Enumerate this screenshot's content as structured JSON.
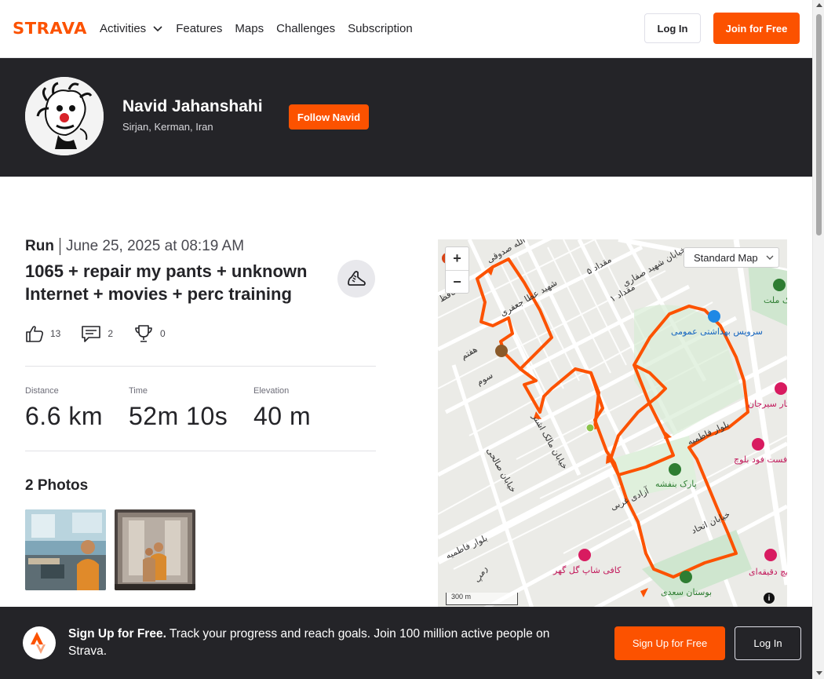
{
  "nav": {
    "logo_text": "STRAVA",
    "links": [
      "Activities",
      "Features",
      "Maps",
      "Challenges",
      "Subscription"
    ],
    "login_label": "Log In",
    "join_label": "Join for Free"
  },
  "athlete": {
    "name": "Navid Jahanshahi",
    "location": "Sirjan, Kerman, Iran",
    "follow_label": "Follow Navid"
  },
  "activity": {
    "sport": "Run",
    "datetime": "June 25, 2025 at 08:19 AM",
    "title": "1065 + repair my pants + unknown Internet + movies + perc training",
    "kudos": "13",
    "comments": "2",
    "achievements": "0",
    "stats": [
      {
        "label": "Distance",
        "value": "6.6 km"
      },
      {
        "label": "Time",
        "value": "52m 10s"
      },
      {
        "label": "Elevation",
        "value": "40 m"
      }
    ],
    "photos_title": "2 Photos"
  },
  "map": {
    "zoom_in": "+",
    "zoom_out": "−",
    "style_select": "Standard Map",
    "scale_label": "300 m",
    "info": "i",
    "labels": {
      "health_service": "سرویس بهداشتی عمومی",
      "park_banafsheh": "پارک بنفشه",
      "cafe": "کافی شاپ گل گهر",
      "bostan": "بوستان سعدی",
      "fastfood": "فست فود بلوچ",
      "fatemieh1": "بلوار فاطمیه",
      "fatemieh2": "بلوار فاطمیه",
      "azadi": "آزادی غربی",
      "ettehad": "خیابان اتحاد",
      "salehi": "خیابان صالحی",
      "malek": "خیابان مالک اشتر",
      "haftom": "هفتم",
      "sevom": "سوم",
      "meghdad5": "مقداد ۵",
      "meghdad1": "مقداد ۱",
      "saffari": "خیابان شهید صفاری",
      "jafari": "شهید عطا جعفری",
      "sadooghi": "آیت الله صدوقی",
      "market": "هایپر استار سیرجان",
      "melat": "پارک ملت",
      "sandwich": "ساندویچ دقیقه‌ای",
      "hafez": "حافظ",
      "ramp": "رمپ"
    }
  },
  "signup": {
    "bold": "Sign Up for Free.",
    "text": " Track your progress and reach goals. Join 100 million active people on Strava.",
    "signup_label": "Sign Up for Free",
    "login_label": "Log In"
  },
  "colors": {
    "brand": "#fc5200",
    "dark": "#242428",
    "route": "#fc5200"
  }
}
